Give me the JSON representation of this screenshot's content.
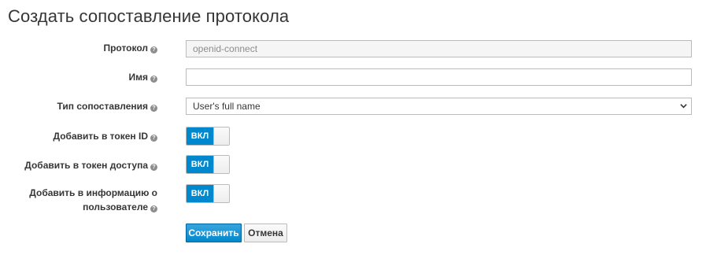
{
  "page": {
    "title": "Создать сопоставление протокола"
  },
  "form": {
    "protocol": {
      "label": "Протокол",
      "value": "openid-connect"
    },
    "name": {
      "label": "Имя",
      "value": "",
      "placeholder": ""
    },
    "mapper_type": {
      "label": "Тип сопоставления",
      "selected": "User's full name"
    },
    "add_to_id_token": {
      "label": "Добавить в токен ID",
      "state": "ВКЛ"
    },
    "add_to_access_token": {
      "label": "Добавить в токен доступа",
      "state": "ВКЛ"
    },
    "add_to_userinfo": {
      "label_line1": "Добавить в информацию о",
      "label_line2": "пользователе",
      "state": "ВКЛ"
    }
  },
  "actions": {
    "save_label": "Сохранить",
    "cancel_label": "Отмена"
  },
  "icons": {
    "help": "question-circle-icon",
    "select_caret": "chevron-down-icon"
  },
  "colors": {
    "primary": "#0088ce",
    "text": "#363636",
    "border": "#bbbbbb",
    "readonly_bg": "#f5f5f5"
  }
}
